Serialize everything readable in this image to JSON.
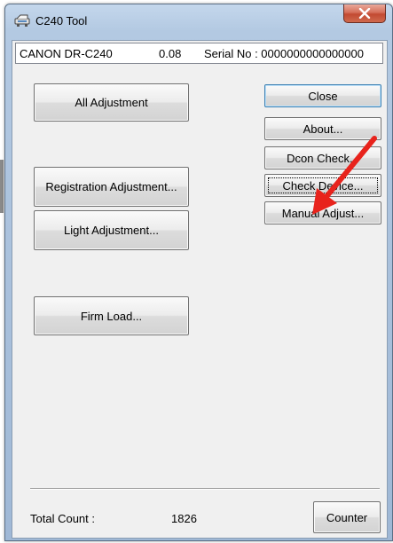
{
  "window": {
    "title": "C240 Tool",
    "close_glyph": "✕"
  },
  "header": {
    "device": "CANON  DR-C240",
    "version": "0.08",
    "serial": "Serial No : 0000000000000000"
  },
  "buttons": {
    "all_adjustment": "All Adjustment",
    "registration_adjustment": "Registration Adjustment...",
    "light_adjustment": "Light Adjustment...",
    "firm_load": "Firm Load...",
    "close": "Close",
    "about": "About...",
    "dcon_check": "Dcon Check...",
    "check_device": "Check Device...",
    "manual_adjust": "Manual Adjust...",
    "counter": "Counter"
  },
  "footer": {
    "total_count_label": "Total Count :",
    "total_count_value": "1826"
  },
  "colors": {
    "arrow": "#e8231c",
    "close_button": "#c9503a"
  },
  "icons": {
    "app": "scanner-app-icon",
    "close": "close-icon",
    "annotation": "red-arrow-annotation"
  }
}
